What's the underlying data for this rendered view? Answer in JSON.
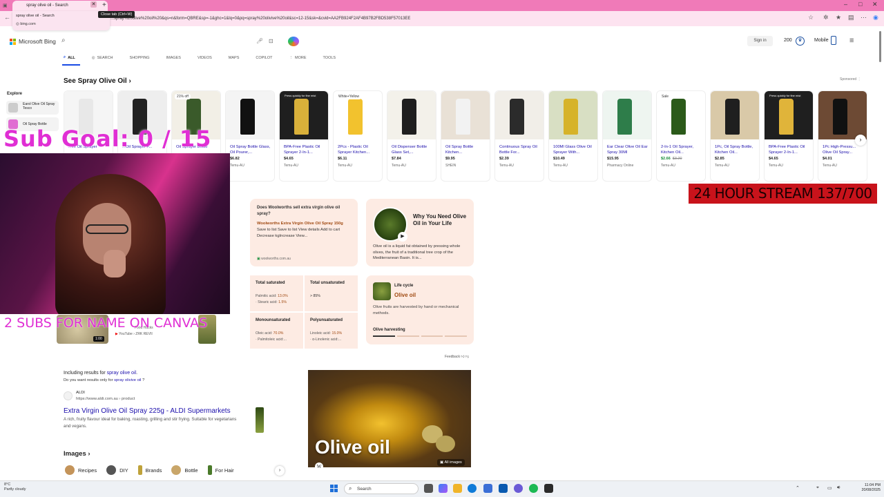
{
  "browser": {
    "tab_title": "spray olive oil - Search",
    "tooltip": "Close tab (Ctrl+W)",
    "dropdown_title": "spray olive oil - Search",
    "dropdown_url": "bing.com",
    "url": "...spray%20olive%20oil%20&qs=n&form=QBRE&sp=-1&ghc=1&lq=0&pq=spray%20olivive%20oil&sc=12-15&sk=&cvid=AA2FB924F2AF4B97B2FBD538F57013EE"
  },
  "bing": {
    "logo_text": "Microsoft Bing",
    "sign_in": "Sign in",
    "points": "200",
    "mobile": "Mobile",
    "nav": [
      "ALL",
      "SEARCH",
      "SHOPPING",
      "IMAGES",
      "VIDEOS",
      "MAPS",
      "COPILOT",
      "MORE",
      "TOOLS"
    ]
  },
  "shopping": {
    "heading": "See Spray Olive Oil",
    "sponsored": "Sponsored",
    "explore_heading": "Explore",
    "explore_items": [
      "Earol Olive Oil Spray Tesco",
      "Oil Spray Bottle"
    ],
    "cards": [
      {
        "title": "...ve Oil Sprayer",
        "price": "",
        "store": "",
        "badge": ""
      },
      {
        "title": "...Oil Sprayer F...",
        "price": "",
        "store": "",
        "badge": ""
      },
      {
        "title": "Oil Sprayer Bottle",
        "price": "",
        "store": "",
        "badge": "21% off"
      },
      {
        "title": "Oil Spray Bottle Glass, Oil Pourer,...",
        "price": "$6.82",
        "store": "Temu-AU",
        "badge": ""
      },
      {
        "title": "BPA-Free Plastic Oil Sprayer 2-In-1...",
        "price": "$4.65",
        "store": "Temu-AU",
        "badge": "Press quickly for fine mist"
      },
      {
        "title": "2Pcs - Plastic Oil Sprayer Kitchen...",
        "price": "$6.11",
        "store": "Temu-AU",
        "badge": "White+Yellow"
      },
      {
        "title": "Oil Dispenser Bottle Glass Set,...",
        "price": "$7.84",
        "store": "Temu-AU",
        "badge": ""
      },
      {
        "title": "Oil Spray Bottle Kitchen...",
        "price": "$9.95",
        "store": "SHEIN",
        "badge": ""
      },
      {
        "title": "Continuous Spray Oil Bottle For...",
        "price": "$2.39",
        "store": "Temu-AU",
        "badge": ""
      },
      {
        "title": "100Ml Glass Olive Oil Sprayer With...",
        "price": "$10.49",
        "store": "Temu-AU",
        "badge": ""
      },
      {
        "title": "Ear Clear Olive Oil Ear Spray 30Ml",
        "price": "$15.95",
        "store": "Pharmacy Online",
        "badge": ""
      },
      {
        "title": "2-In-1 Oil Sprayer, Kitchen Oil...",
        "price": "$2.66",
        "old_price": "$3.20",
        "store": "Temu-AU",
        "badge": "Sale"
      },
      {
        "title": "1Pc, Oil Spray Bottle, Kitchen Oil...",
        "price": "$2.85",
        "store": "Temu-AU",
        "badge": ""
      },
      {
        "title": "BPA-Free Plastic Oil Sprayer 2-In-1...",
        "price": "$4.65",
        "store": "Temu-AU",
        "badge": "Press quickly for fine mist"
      },
      {
        "title": "1Pc High-Pressu... Olive Oil Spray...",
        "price": "$4.01",
        "store": "Temu-AU",
        "badge": ""
      }
    ]
  },
  "overlay": {
    "sub_goal": "Sub Goal:  0 / 15",
    "stream": "24 HOUR STREAM 137/700",
    "subs": "2 SUBS FOR NAME ON CANVAS"
  },
  "video": {
    "duration": "1:00",
    "source": "YouTube › ZRK REVII",
    "partial": "Food Hacks"
  },
  "answers": {
    "qa_question": "Does Woolworths sell extra virgin olive oil spray?",
    "qa_answer_bold": "Woolworths Extra Virgin Olive Oil Spray 150g",
    "qa_answer_rest": " Save to list Save to list View details Add to cart Decrease kgIncrease View...",
    "qa_source": "woolworths.com.au",
    "why_title": "Why You Need Olive Oil in Your Life",
    "why_body": "Olive oil is a liquid fat obtained by pressing whole olives, the fruit of a traditional tree crop of the Mediterranean Basin. It is...",
    "facts": [
      {
        "h": "Total saturated",
        "v1": "Palmitic acid: ",
        "n1": "13.0%",
        "v2": "· Stearic acid: ",
        "n2": "1.5%"
      },
      {
        "h": "Total unsaturated",
        "v1": "> 85%",
        "n1": "",
        "v2": "",
        "n2": ""
      },
      {
        "h": "Monounsaturated",
        "v1": "Oleic acid: ",
        "n1": "70.0%",
        "v2": "· Palmitoleic acid:...",
        "n2": ""
      },
      {
        "h": "Polyunsaturated",
        "v1": "Linoleic acid: ",
        "n1": "15.0%",
        "v2": "· α-Linolenic acid:...",
        "n2": ""
      }
    ],
    "life_label": "Life cycle",
    "life_name": "Olive oil",
    "life_body": "Olive fruits are harvested by hand or mechanical methods.",
    "life_step": "Olive harvesting",
    "feedback": "Feedback"
  },
  "results": {
    "incl_prefix": "Including results for ",
    "incl_link": "spray olive oil",
    "only_prefix": "Do you want results only for ",
    "only_link": "spray olivive oil",
    "only_suffix": " ?",
    "site": "ALDI",
    "url": "https://www.aldi.com.au › product",
    "title": "Extra Virgin Olive Oil Spray 225g - ALDI Supermarkets",
    "desc": "A rich, fruity flavour ideal for baking, roasting, grilling and stir frying. Suitable for vegetarians and vegans.",
    "image_caption": "Olive oil",
    "all_images": "All images",
    "images_heading": "Images",
    "chips": [
      "Recipes",
      "DIY",
      "Brands",
      "Bottle",
      "For Hair"
    ]
  },
  "taskbar": {
    "temp": "8°C",
    "weather": "Partly cloudy",
    "search": "Search",
    "time": "11:04 PM",
    "date": "20/08/2025"
  }
}
